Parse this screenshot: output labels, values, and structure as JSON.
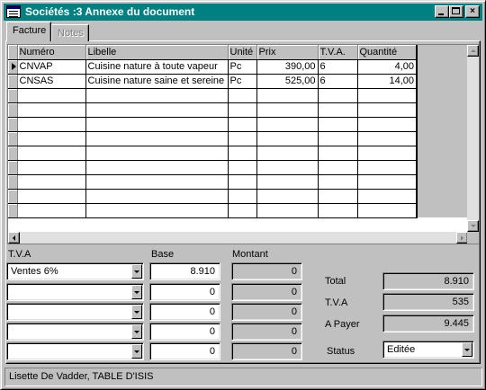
{
  "window": {
    "title": "Sociétés :3 Annexe du document",
    "buttons": {
      "minimize": "minimize",
      "maximize": "maximize",
      "close": "×"
    }
  },
  "tabs": [
    {
      "label": "Facture",
      "active": true
    },
    {
      "label": "Notes",
      "active": false
    }
  ],
  "grid": {
    "columns": [
      "Numéro",
      "Libelle",
      "Unité",
      "Prix",
      "T.V.A.",
      "Quantité"
    ],
    "rows": [
      {
        "numero": "CNVAP",
        "libelle": "Cuisine nature à toute vapeur",
        "unite": "Pc",
        "prix": "390,00",
        "tva": "6",
        "quantite": "4,00"
      },
      {
        "numero": "CNSAS",
        "libelle": "Cuisine nature saine et sereine",
        "unite": "Pc",
        "prix": "525,00",
        "tva": "6",
        "quantite": "14,00"
      }
    ]
  },
  "tva_section": {
    "headers": {
      "tva": "T.V.A",
      "base": "Base",
      "montant": "Montant"
    },
    "rows": [
      {
        "tva": "Ventes 6%",
        "base": "8.910",
        "montant": "0"
      },
      {
        "tva": "",
        "base": "0",
        "montant": "0"
      },
      {
        "tva": "",
        "base": "0",
        "montant": "0"
      },
      {
        "tva": "",
        "base": "0",
        "montant": "0"
      },
      {
        "tva": "",
        "base": "0",
        "montant": "0"
      }
    ]
  },
  "totals": {
    "total_label": "Total",
    "total_value": "8.910",
    "tva_label": "T.V.A",
    "tva_value": "535",
    "apayer_label": "A Payer",
    "apayer_value": "9.445",
    "status_label": "Status",
    "status_value": "Editée"
  },
  "statusbar": {
    "text": "Lisette De Vadder, TABLE D'ISIS"
  },
  "colors": {
    "titlebar": "#008080",
    "face": "#c0c0c0",
    "field": "#ffffff"
  }
}
